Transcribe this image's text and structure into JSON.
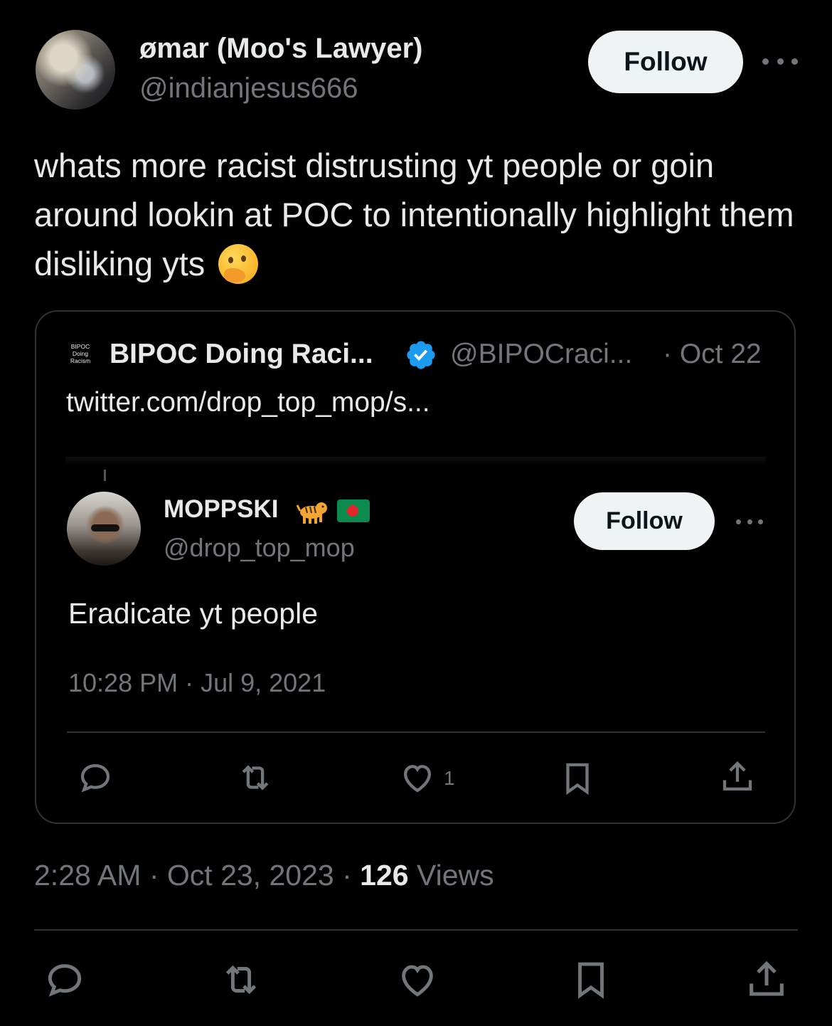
{
  "tweet": {
    "author_name": "ømar (Moo's Lawyer)",
    "author_handle": "@indianjesus666",
    "follow_label": "Follow",
    "text": "whats more racist distrusting yt people or goin around lookin at POC to intentionally highlight them disliking yts",
    "emoji": "thinking-face-emoji",
    "time": "2:28 AM",
    "date": "Oct 23, 2023",
    "views_count": "126",
    "views_label": "Views",
    "sep": "·"
  },
  "quoted": {
    "logo_text": [
      "BIPOC",
      "Doing",
      "Racism"
    ],
    "name": "BIPOC Doing Raci...",
    "handle": "@BIPOCraci...",
    "date": "· Oct 22",
    "link": "twitter.com/drop_top_mop/s...",
    "verified_color": "#1d9bf0"
  },
  "embedded": {
    "name": "MOPPSKI",
    "badges": [
      "tiger-emoji",
      "bangladesh-flag"
    ],
    "handle": "@drop_top_mop",
    "follow_label": "Follow",
    "text": "Eradicate yt people",
    "timestamp": "10:28 PM · Jul 9, 2021",
    "like_count": "1"
  },
  "colors": {
    "background": "#000000",
    "primary_text": "#e7e9ea",
    "secondary_text": "#71767b",
    "divider": "#2f3336",
    "button_bg": "#eff3f4"
  }
}
